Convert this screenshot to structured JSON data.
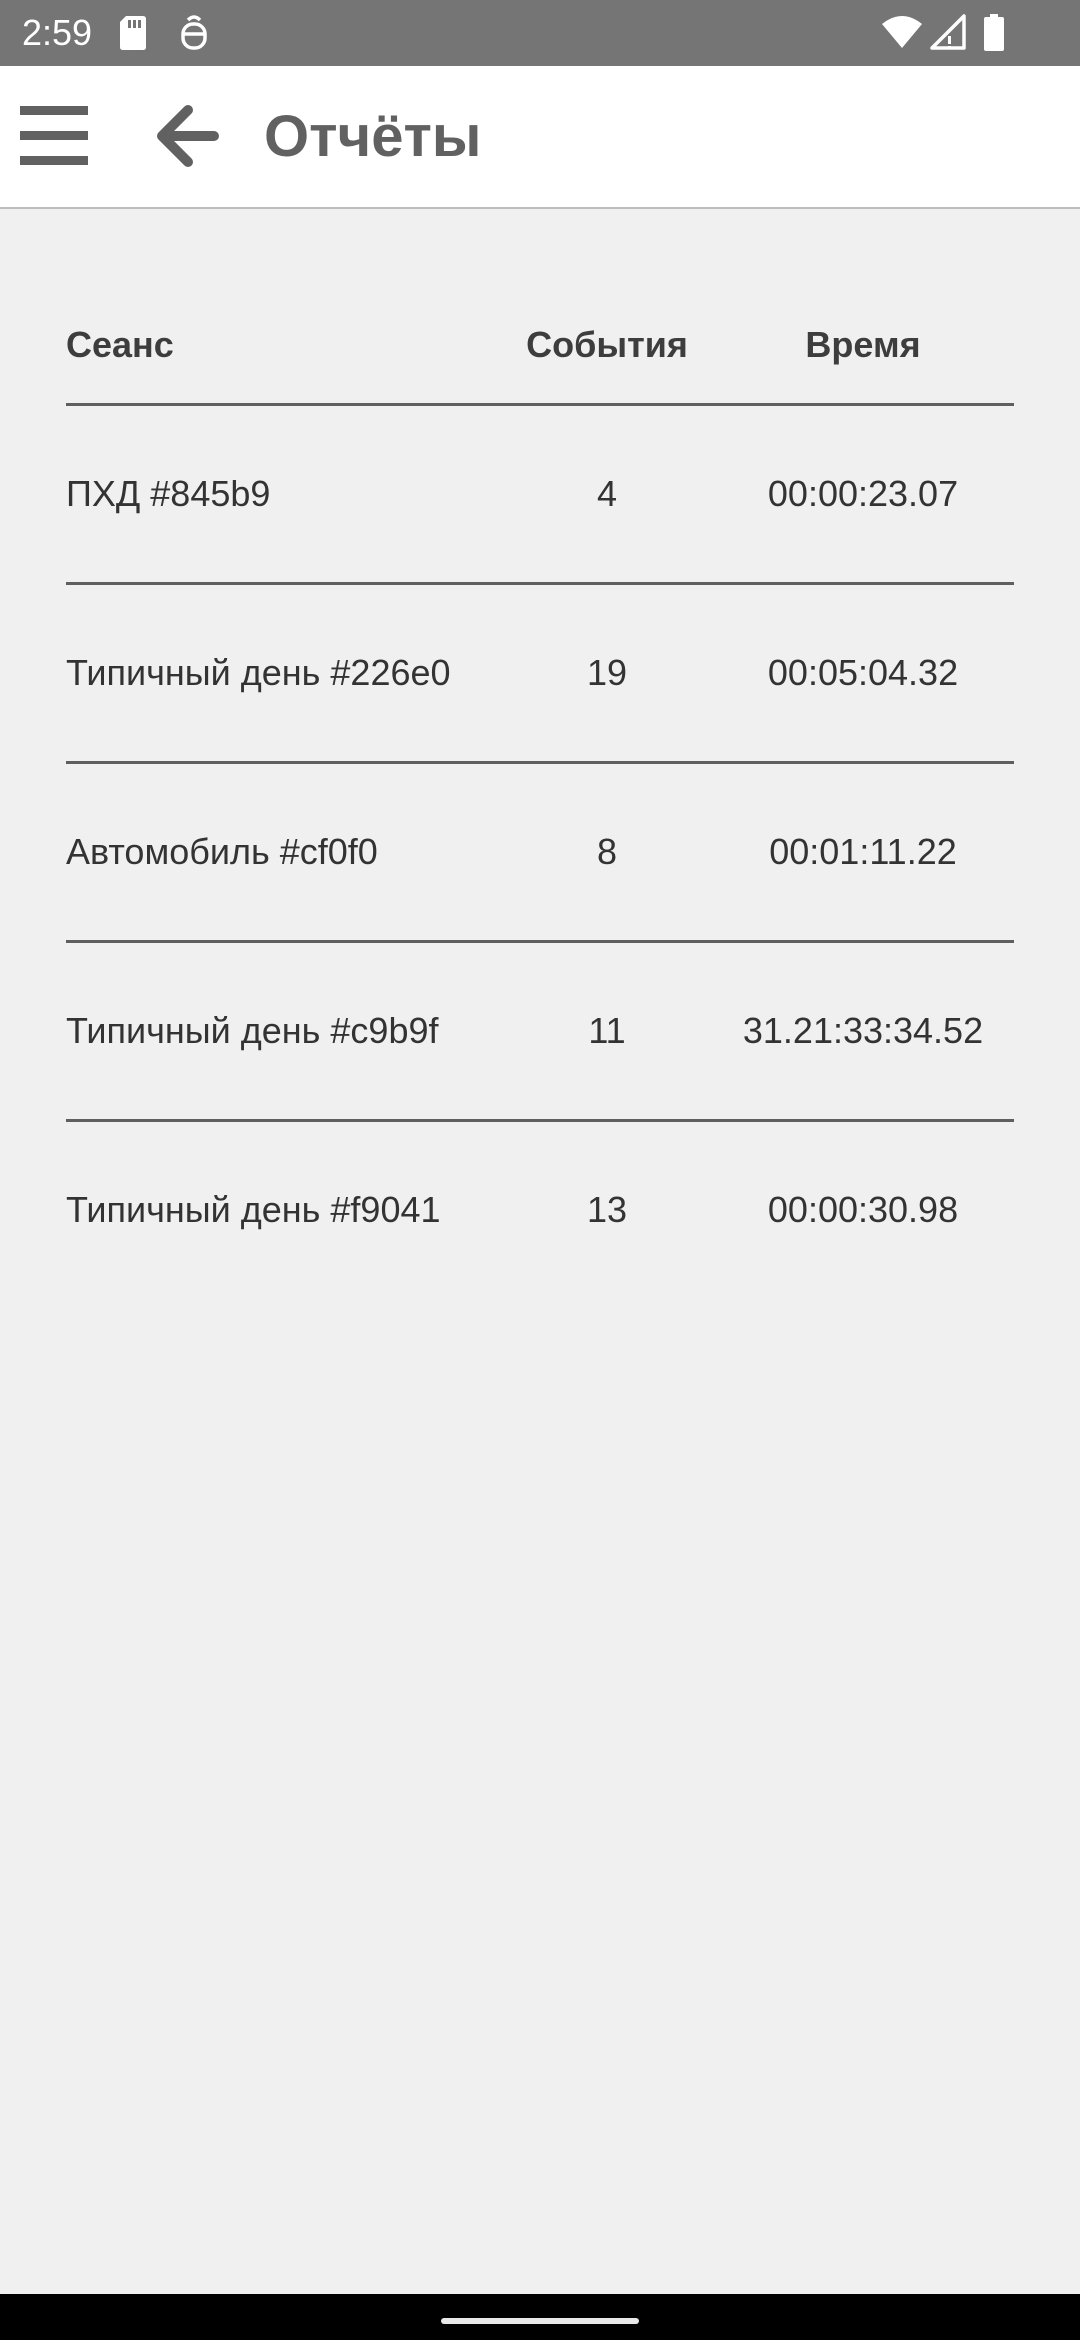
{
  "status_bar": {
    "time": "2:59",
    "icons": [
      "sd-card-icon",
      "assistant-icon",
      "wifi-icon",
      "signal-icon",
      "battery-icon"
    ]
  },
  "app_bar": {
    "title": "Отчёты",
    "menu_icon": "hamburger-menu-icon",
    "back_icon": "arrow-back-icon"
  },
  "table": {
    "headers": {
      "session": "Сеанс",
      "events": "События",
      "time": "Время"
    },
    "rows": [
      {
        "session": "ПХД #845b9",
        "events": "4",
        "time": "00:00:23.07"
      },
      {
        "session": "Типичный день #226e0",
        "events": "19",
        "time": "00:05:04.32"
      },
      {
        "session": "Автомобиль #cf0f0",
        "events": "8",
        "time": "00:01:11.22"
      },
      {
        "session": "Типичный день #c9b9f",
        "events": "11",
        "time": "31.21:33:34.52"
      },
      {
        "session": "Типичный день #f9041",
        "events": "13",
        "time": "00:00:30.98"
      }
    ]
  },
  "colors": {
    "status_bar": "#757575",
    "app_bar": "#ffffff",
    "background": "#f0f0f0",
    "title": "#616161",
    "divider": "#5f5f5f",
    "nav_bar": "#000000"
  }
}
